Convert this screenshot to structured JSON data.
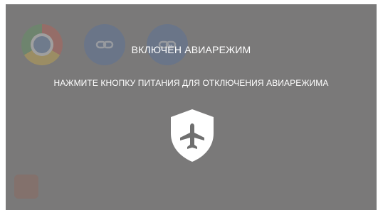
{
  "overlay": {
    "title": "ВКЛЮЧЁН АВИАРЕЖИМ",
    "message": "НАЖМИТЕ КНОПКУ ПИТАНИЯ ДЛЯ ОТКЛЮЧЕНИЯ АВИАРЕЖИМА",
    "icon": "airplane-shield-icon"
  },
  "background_apps": [
    {
      "icon": "chrome-icon"
    },
    {
      "icon": "link-icon"
    },
    {
      "icon": "link-icon"
    }
  ],
  "colors": {
    "overlay_background": "#7a7979",
    "text": "#ffffff",
    "shield_fill": "#ffffff",
    "airplane_fill": "#6f6f6f"
  }
}
